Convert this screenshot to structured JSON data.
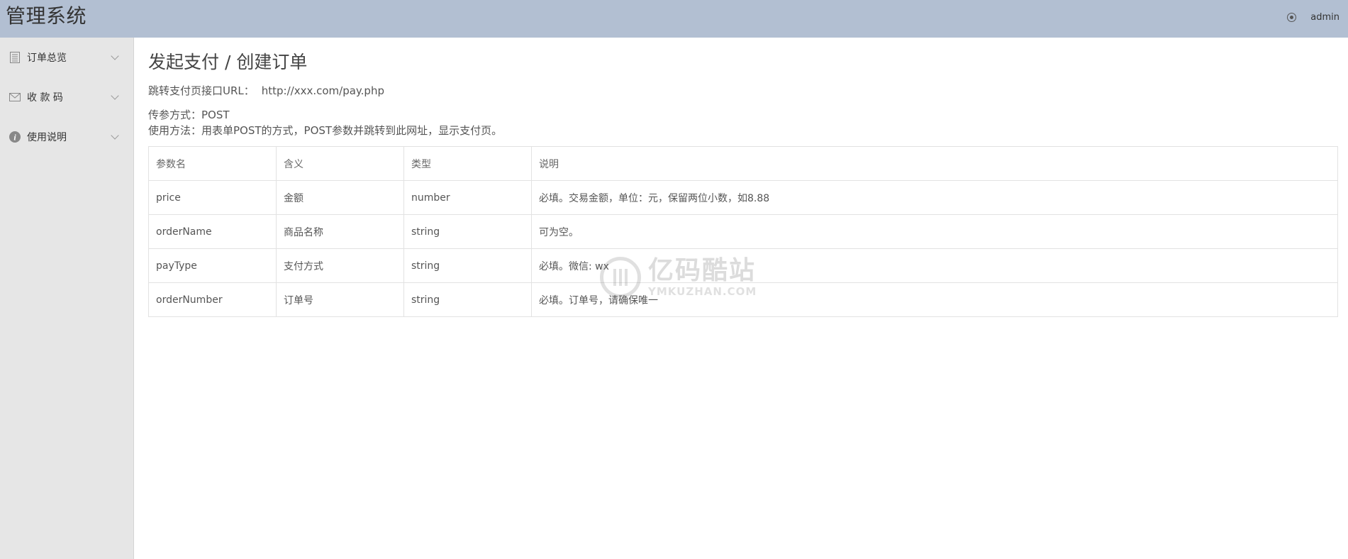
{
  "header": {
    "title": "管理系统",
    "user": "admin"
  },
  "sidebar": {
    "items": [
      {
        "label": "订单总览",
        "icon": "list-icon"
      },
      {
        "label": "收 款 码",
        "icon": "mail-icon"
      },
      {
        "label": "使用说明",
        "icon": "info-icon"
      }
    ]
  },
  "main": {
    "title": "发起支付 / 创建订单",
    "url_label": "跳转支付页接口URL：",
    "url_value": "http://xxx.com/pay.php",
    "method_line": "传参方式：POST",
    "usage_line": "使用方法：用表单POST的方式，POST参数并跳转到此网址，显示支付页。",
    "table": {
      "headers": [
        "参数名",
        "含义",
        "类型",
        "说明"
      ],
      "rows": [
        [
          "price",
          "金额",
          "number",
          "必填。交易金额，单位：元，保留两位小数，如8.88"
        ],
        [
          "orderName",
          "商品名称",
          "string",
          "可为空。"
        ],
        [
          "payType",
          "支付方式",
          "string",
          "必填。微信: wx"
        ],
        [
          "orderNumber",
          "订单号",
          "string",
          "必填。订单号，请确保唯一"
        ]
      ]
    }
  },
  "watermark": {
    "cn": "亿码酷站",
    "en": "YMKUZHAN.COM"
  }
}
